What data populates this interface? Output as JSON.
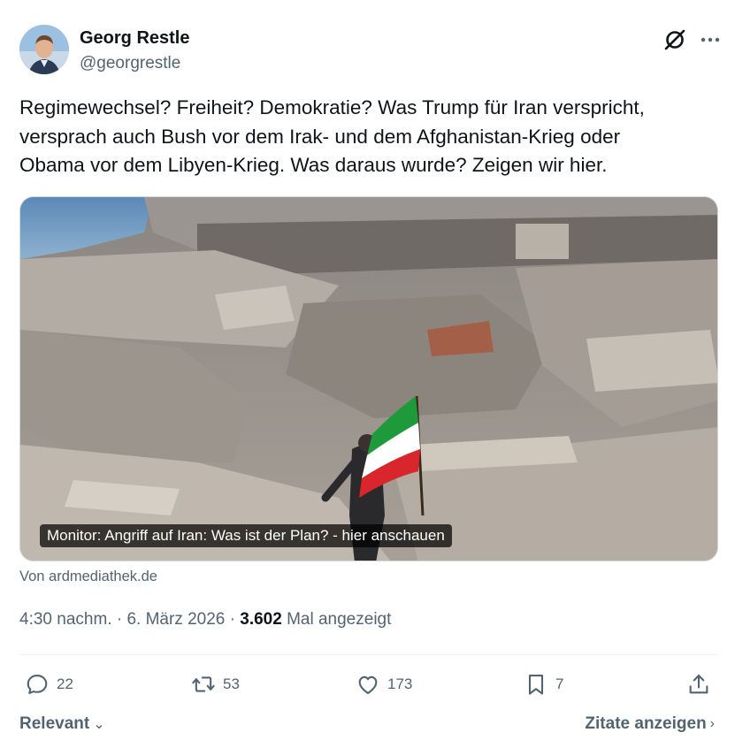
{
  "author": {
    "name": "Georg Restle",
    "handle": "@georgrestle"
  },
  "header_icons": [
    "grok-icon",
    "more-icon"
  ],
  "tweet": {
    "text_lines": [
      "Regimewechsel? Freiheit? Demokratie? Was Trump für Iran verspricht,",
      "versprach auch Bush vor dem Irak- und dem Afghanistan-Krieg oder",
      "Obama vor dem Libyen-Krieg. Was daraus wurde? Zeigen wir hier."
    ]
  },
  "card": {
    "caption": "Monitor: Angriff auf Iran: Was ist der Plan? - hier anschauen",
    "source": "Von ardmediathek.de"
  },
  "meta": {
    "time": "4:30 nachm.",
    "sep1": " · ",
    "date": "6. März 2026",
    "sep2": " · ",
    "views": "3.602",
    "views_label": " Mal angezeigt"
  },
  "actions": {
    "replies": "22",
    "reposts": "53",
    "likes": "173",
    "bookmarks": "7"
  },
  "footer": {
    "sort_label": "Relevant",
    "quotes_label": "Zitate anzeigen"
  },
  "colors": {
    "text": "#0f1419",
    "muted": "#536471",
    "divider": "#eff3f4"
  }
}
